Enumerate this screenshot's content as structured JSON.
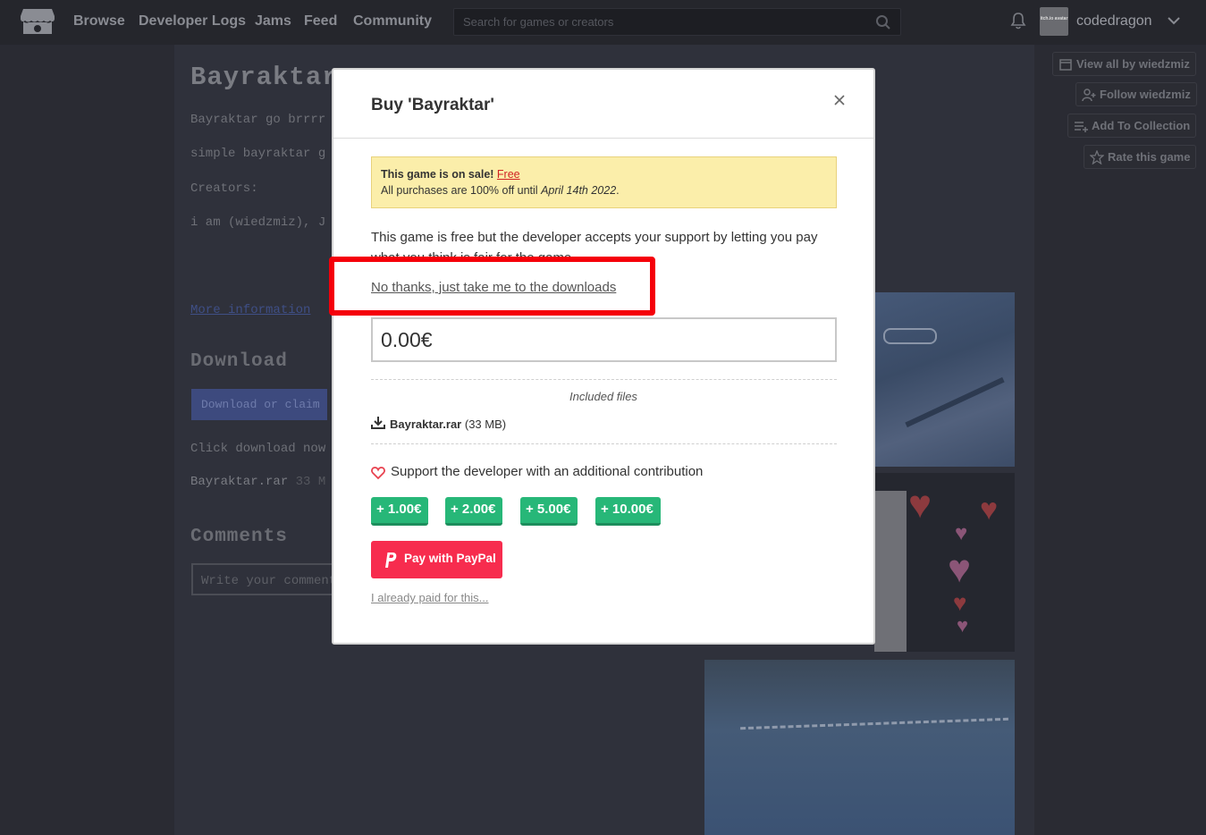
{
  "nav": {
    "links": [
      "Browse",
      "Developer Logs",
      "Jams",
      "Feed",
      "Community"
    ],
    "search_placeholder": "Search for games or creators",
    "username": "codedragon",
    "avatar_text": "itch.io avatar"
  },
  "game": {
    "title": "Bayraktar",
    "desc1": "Bayraktar go brrrr",
    "desc2": "simple bayraktar g",
    "creators_label": "Creators:",
    "creators": "i am (wiedzmiz), J",
    "more_info": "More information",
    "download_heading": "Download",
    "download_button": "Download or claim",
    "click_text": "Click download now",
    "file_name": "Bayraktar.rar",
    "file_size": "33 M",
    "comments_heading": "Comments",
    "comment_placeholder": "Write your comment"
  },
  "sidebar": {
    "view_all": "View all by wiedzmiz",
    "follow": "Follow wiedzmiz",
    "add_collection": "Add To Collection",
    "rate": "Rate this game"
  },
  "modal": {
    "title": "Buy 'Bayraktar'",
    "sale_strong": "This game is on sale!",
    "sale_link": "Free",
    "sale_line_prefix": "All purchases are 100% off until",
    "sale_date": "April 14th 2022",
    "sale_period": ".",
    "description": "This game is free but the developer accepts your support by letting you pay what you think is fair for the game.",
    "no_thanks": "No thanks, just take me to the downloads",
    "price": "0.00€",
    "included_files_label": "Included files",
    "file_name": "Bayraktar.rar",
    "file_size": "(33 MB)",
    "support_text": "Support the developer with an additional contribution",
    "tips": [
      "+ 1.00€",
      "+ 2.00€",
      "+ 5.00€",
      "+ 10.00€"
    ],
    "paypal_label": "Pay with PayPal",
    "already_paid": "I already paid for this..."
  },
  "colors": {
    "highlight": "#f5000a",
    "tip_green": "#27b778",
    "paypal_red": "#f72c4e",
    "sale_bg": "#fbeeaa"
  }
}
